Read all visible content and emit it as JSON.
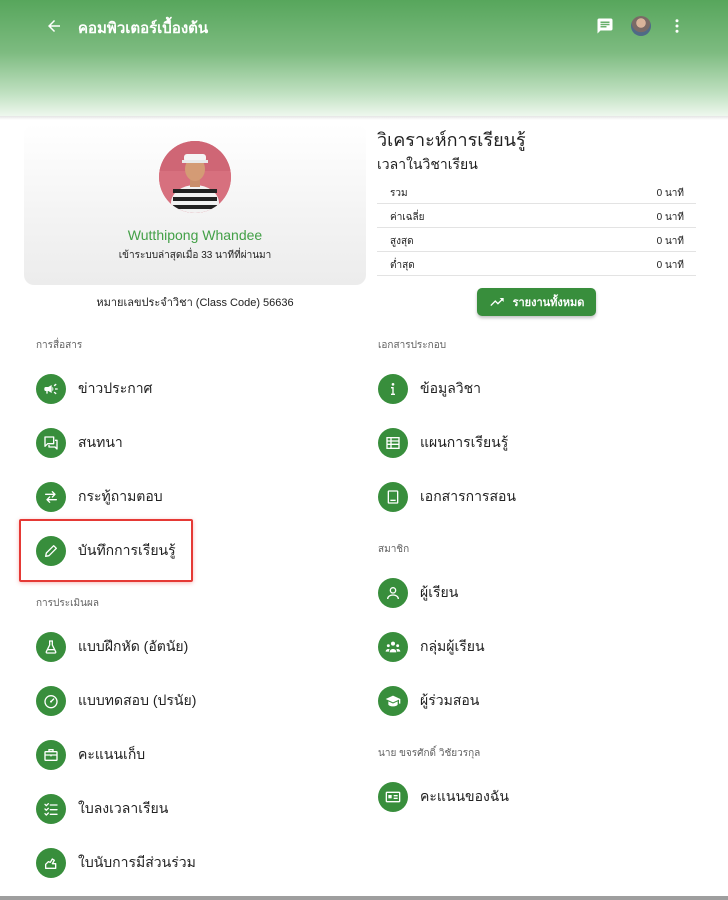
{
  "header": {
    "title": "คอมพิวเตอร์เบื้องต้น",
    "icons": [
      "back-arrow-icon",
      "chat-icon",
      "user-avatar",
      "more-vert-icon"
    ]
  },
  "profile": {
    "name": "Wutthipong Whandee",
    "last_login": "เข้าระบบล่าสุดเมื่อ 33 นาทีที่ผ่านมา",
    "class_code": "หมายเลขประจำวิชา (Class Code) 56636"
  },
  "analytics": {
    "title": "วิเคราะห์การเรียนรู้",
    "subtitle": "เวลาในวิชาเรียน",
    "rows": [
      {
        "label": "รวม",
        "value": "0 นาที"
      },
      {
        "label": "ค่าเฉลี่ย",
        "value": "0 นาที"
      },
      {
        "label": "สูงสุด",
        "value": "0 นาที"
      },
      {
        "label": "ต่ำสุด",
        "value": "0 นาที"
      }
    ],
    "report_button": "รายงานทั้งหมด"
  },
  "communication": {
    "title": "การสื่อสาร",
    "items": [
      {
        "label": "ข่าวประกาศ",
        "icon": "megaphone-icon"
      },
      {
        "label": "สนทนา",
        "icon": "forum-icon"
      },
      {
        "label": "กระทู้ถามตอบ",
        "icon": "swap-icon"
      },
      {
        "label": "บันทึกการเรียนรู้",
        "icon": "pencil-icon"
      }
    ]
  },
  "evaluation": {
    "title": "การประเมินผล",
    "items": [
      {
        "label": "แบบฝึกหัด (อัตนัย)",
        "icon": "flask-icon"
      },
      {
        "label": "แบบทดสอบ (ปรนัย)",
        "icon": "speedometer-icon"
      },
      {
        "label": "คะแนนเก็บ",
        "icon": "briefcase-icon"
      },
      {
        "label": "ใบลงเวลาเรียน",
        "icon": "checklist-icon"
      },
      {
        "label": "ใบนับการมีส่วนร่วม",
        "icon": "hand-icon"
      }
    ]
  },
  "documents": {
    "title": "เอกสารประกอบ",
    "items": [
      {
        "label": "ข้อมูลวิชา",
        "icon": "info-icon"
      },
      {
        "label": "แผนการเรียนรู้",
        "icon": "table-icon"
      },
      {
        "label": "เอกสารการสอน",
        "icon": "book-icon"
      }
    ]
  },
  "members": {
    "title": "สมาชิก",
    "items": [
      {
        "label": "ผู้เรียน",
        "icon": "person-icon"
      },
      {
        "label": "กลุ่มผู้เรียน",
        "icon": "group-icon"
      },
      {
        "label": "ผู้ร่วมสอน",
        "icon": "graduation-cap-icon"
      }
    ]
  },
  "personal": {
    "title": "นาย ขจรศักดิ์ วิชัยวรกุล",
    "items": [
      {
        "label": "คะแนนของฉัน",
        "icon": "id-card-icon"
      }
    ]
  },
  "colors": {
    "primary": "#388e3c",
    "accent_text": "#43a047",
    "highlight": "#e53935"
  }
}
